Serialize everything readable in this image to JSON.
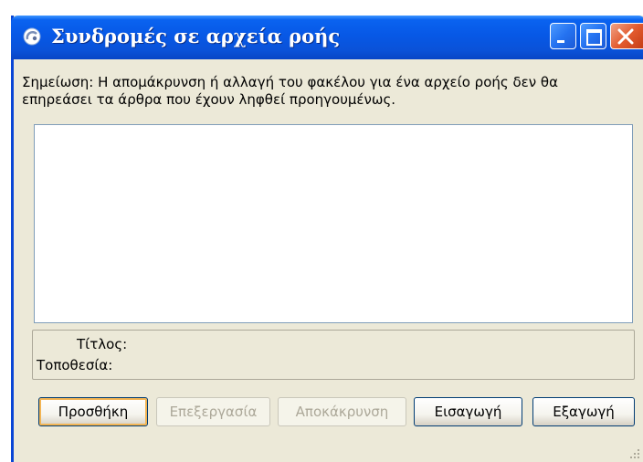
{
  "window": {
    "title": "Συνδρομές σε αρχεία ροής",
    "colors": {
      "titlebar": "#0758e6",
      "body": "#ece9d8",
      "close": "#e25a2e"
    }
  },
  "note": "Σημείωση: Η απομάκρυνση ή αλλαγή του φακέλου για ένα αρχείο ροής δεν θα επηρεάσει τα άρθρα που έχουν ληφθεί προηγουμένως.",
  "details": {
    "title_label": "Τίτλος:",
    "location_label": "Τοποθεσία:"
  },
  "buttons": {
    "add": "Προσθήκη",
    "edit": "Επεξεργασία",
    "remove": "Αποκάκρυνση",
    "import": "Εισαγωγή",
    "export": "Εξαγωγή"
  },
  "icons": {
    "app": "feed-icon",
    "minimize": "minimize-icon",
    "maximize": "maximize-icon",
    "close": "close-icon"
  }
}
